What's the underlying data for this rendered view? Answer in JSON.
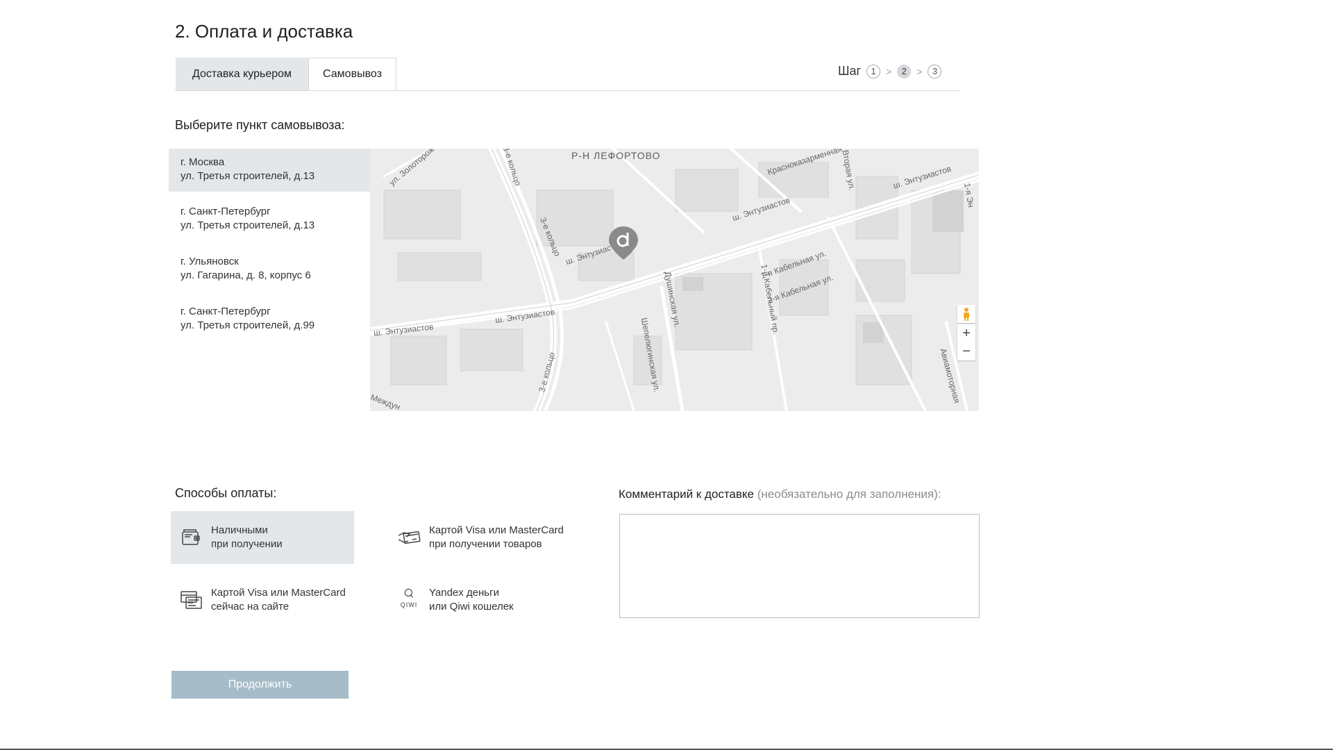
{
  "page": {
    "title": "2. Оплата и доставка"
  },
  "tabs": [
    {
      "label": "Доставка курьером",
      "active": false
    },
    {
      "label": "Самовывоз",
      "active": true
    }
  ],
  "steps": {
    "label": "Шаг",
    "items": [
      "1",
      "2",
      "3"
    ],
    "current": 2
  },
  "pickup": {
    "label": "Выберите пункт самовывоза:",
    "points": [
      {
        "city": "г. Москва",
        "address": "ул. Третья строителей, д.13",
        "selected": true
      },
      {
        "city": "г. Санкт-Петербург",
        "address": "ул. Третья строителей, д.13",
        "selected": false
      },
      {
        "city": "г. Ульяновск",
        "address": "ул. Гагарина, д. 8, корпус 6",
        "selected": false
      },
      {
        "city": "г. Санкт-Петербург",
        "address": "ул. Третья строителей, д.99",
        "selected": false
      }
    ]
  },
  "map": {
    "labels": {
      "district": "Р-Н ЛЕФОРТОВО",
      "entuz_1": "ш. Энтузиастов",
      "entuz_2": "ш. Энтузиастов",
      "entuz_3": "ш. Энтузиастов",
      "entuz_4": "ш. Энтузиастов",
      "entuz_5": "ш. Энтузиастов",
      "koltso_1": "3-е кольцо",
      "koltso_2": "3-е кольцо",
      "koltso_3": "3-е кольцо",
      "dushinskaya": "Душинская ул.",
      "shepeli": "Шепелюгинская ул.",
      "kabel_1": "1-я Кабельная ул.",
      "kabel_2": "2-я Кабельная ул.",
      "kabel_pr": "1-й Кабельный пр.",
      "aviamotor": "Авиамоторная",
      "zolotor": "ул. Золоторож",
      "raskaz": "Красноказарменная",
      "vtoraya": "Вторая ул.",
      "mezhdun": "Междун",
      "e1": "1-я Эн"
    },
    "zoom_in": "+",
    "zoom_out": "−"
  },
  "payment": {
    "label": "Способы оплаты:",
    "options": [
      {
        "line1": "Наличными",
        "line2": "при получении",
        "icon": "wallet-icon",
        "selected": true
      },
      {
        "line1": "Картой Visa или MasterCard",
        "line2": "при получении товаров",
        "icon": "card-hand-icon",
        "selected": false
      },
      {
        "line1": "Картой Visa или MasterCard",
        "line2": "сейчас на сайте",
        "icon": "card-terminal-icon",
        "selected": false
      },
      {
        "line1": "Yandex деньги",
        "line2": "или Qiwi кошелек",
        "icon": "qiwi-icon",
        "selected": false
      }
    ],
    "qiwi_text": "QIWI"
  },
  "comment": {
    "label": "Комментарий к доставке",
    "hint": "(необязательно для заполнения):",
    "value": ""
  },
  "actions": {
    "continue": "Продолжить"
  },
  "colors": {
    "selected_bg": "#e4e7ea",
    "button_bg": "#a7bcc9",
    "pin": "#8a8a8a"
  }
}
